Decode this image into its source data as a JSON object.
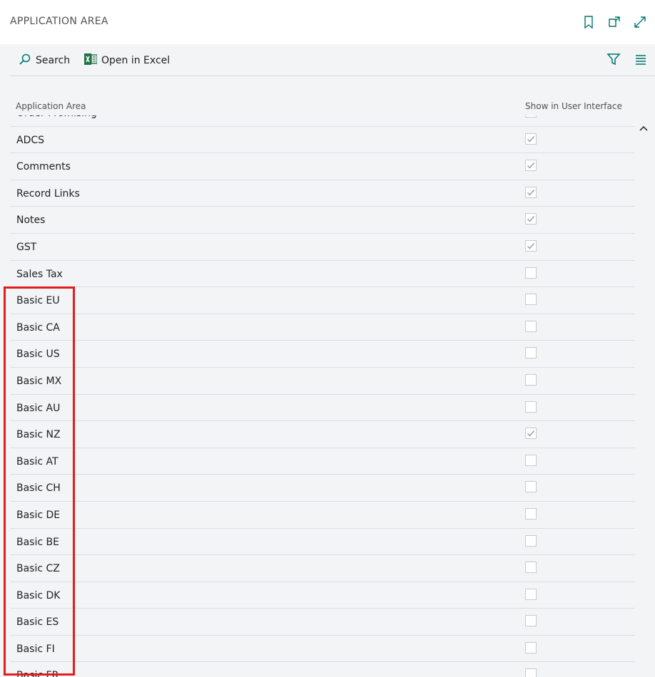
{
  "page": {
    "title": "APPLICATION AREA"
  },
  "header_icons": [
    "bookmark-icon",
    "open-in-new-window-icon",
    "expand-icon"
  ],
  "toolbar": {
    "search_label": "Search",
    "excel_label": "Open in Excel"
  },
  "toolbar_icons": [
    "filter-icon",
    "list-view-icon"
  ],
  "columns": {
    "area": "Application Area",
    "show": "Show in User Interface"
  },
  "rows": [
    {
      "name": "Order Promising",
      "checked": true
    },
    {
      "name": "ADCS",
      "checked": true
    },
    {
      "name": "Comments",
      "checked": true
    },
    {
      "name": "Record Links",
      "checked": true
    },
    {
      "name": "Notes",
      "checked": true
    },
    {
      "name": "GST",
      "checked": true
    },
    {
      "name": "Sales Tax",
      "checked": false
    },
    {
      "name": "Basic EU",
      "checked": false
    },
    {
      "name": "Basic CA",
      "checked": false
    },
    {
      "name": "Basic US",
      "checked": false
    },
    {
      "name": "Basic MX",
      "checked": false
    },
    {
      "name": "Basic AU",
      "checked": false
    },
    {
      "name": "Basic NZ",
      "checked": true
    },
    {
      "name": "Basic AT",
      "checked": false
    },
    {
      "name": "Basic CH",
      "checked": false
    },
    {
      "name": "Basic DE",
      "checked": false
    },
    {
      "name": "Basic BE",
      "checked": false
    },
    {
      "name": "Basic CZ",
      "checked": false
    },
    {
      "name": "Basic DK",
      "checked": false
    },
    {
      "name": "Basic ES",
      "checked": false
    },
    {
      "name": "Basic FI",
      "checked": false
    },
    {
      "name": "Basic FR",
      "checked": false
    }
  ],
  "colors": {
    "highlight": "#e31d1d",
    "accent": "#00756c",
    "excel_green": "#217346"
  }
}
